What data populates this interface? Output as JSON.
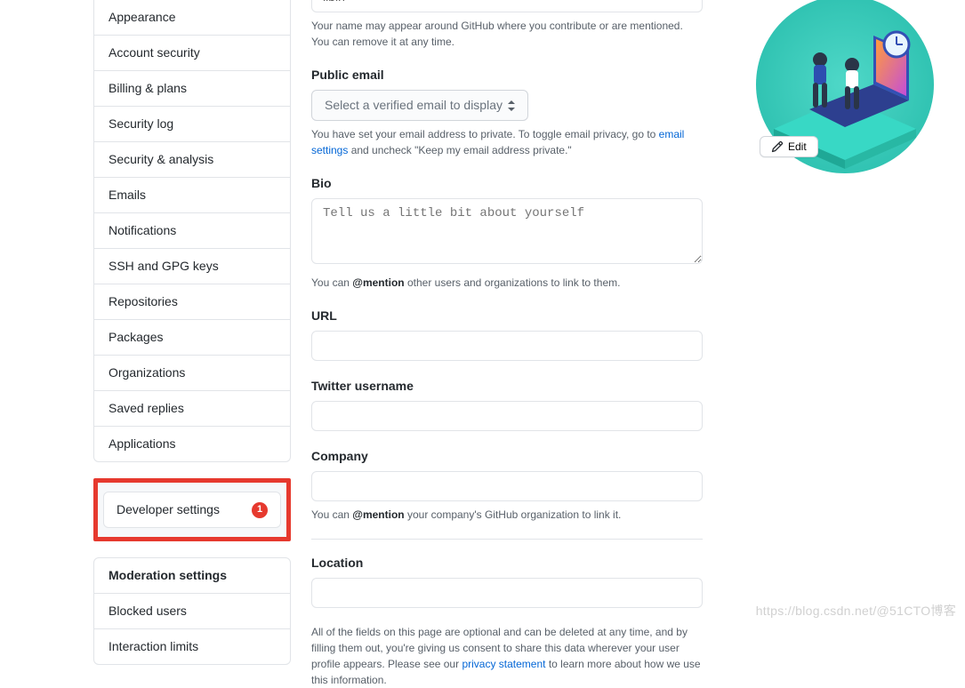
{
  "sidebar": {
    "items": [
      {
        "label": "Appearance"
      },
      {
        "label": "Account security"
      },
      {
        "label": "Billing & plans"
      },
      {
        "label": "Security log"
      },
      {
        "label": "Security & analysis"
      },
      {
        "label": "Emails"
      },
      {
        "label": "Notifications"
      },
      {
        "label": "SSH and GPG keys"
      },
      {
        "label": "Repositories"
      },
      {
        "label": "Packages"
      },
      {
        "label": "Organizations"
      },
      {
        "label": "Saved replies"
      },
      {
        "label": "Applications"
      }
    ],
    "developer_label": "Developer settings",
    "developer_badge": "1",
    "moderation_header": "Moderation settings",
    "moderation_items": [
      {
        "label": "Blocked users"
      },
      {
        "label": "Interaction limits"
      }
    ]
  },
  "form": {
    "name_value": "libin",
    "name_note_a": "Your name may appear around GitHub where you contribute or are mentioned. You can remove it at any time.",
    "public_email_label": "Public email",
    "public_email_placeholder": "Select a verified email to display",
    "email_note_a": "You have set your email address to private. To toggle email privacy, go to ",
    "email_note_link": "email settings",
    "email_note_b": " and uncheck \"Keep my email address private.\"",
    "bio_label": "Bio",
    "bio_placeholder": "Tell us a little bit about yourself",
    "bio_note_a": "You can ",
    "bio_note_strong": "@mention",
    "bio_note_b": " other users and organizations to link to them.",
    "url_label": "URL",
    "twitter_label": "Twitter username",
    "company_label": "Company",
    "company_note_a": "You can ",
    "company_note_strong": "@mention",
    "company_note_b": " your company's GitHub organization to link it.",
    "location_label": "Location",
    "footer_note_a": "All of the fields on this page are optional and can be deleted at any time, and by filling them out, you're giving us consent to share this data wherever your user profile appears. Please see our ",
    "footer_note_link": "privacy statement",
    "footer_note_b": " to learn more about how we use this information."
  },
  "avatar": {
    "edit_label": "Edit"
  },
  "watermark": "https://blog.csdn.net/@51CTO博客"
}
